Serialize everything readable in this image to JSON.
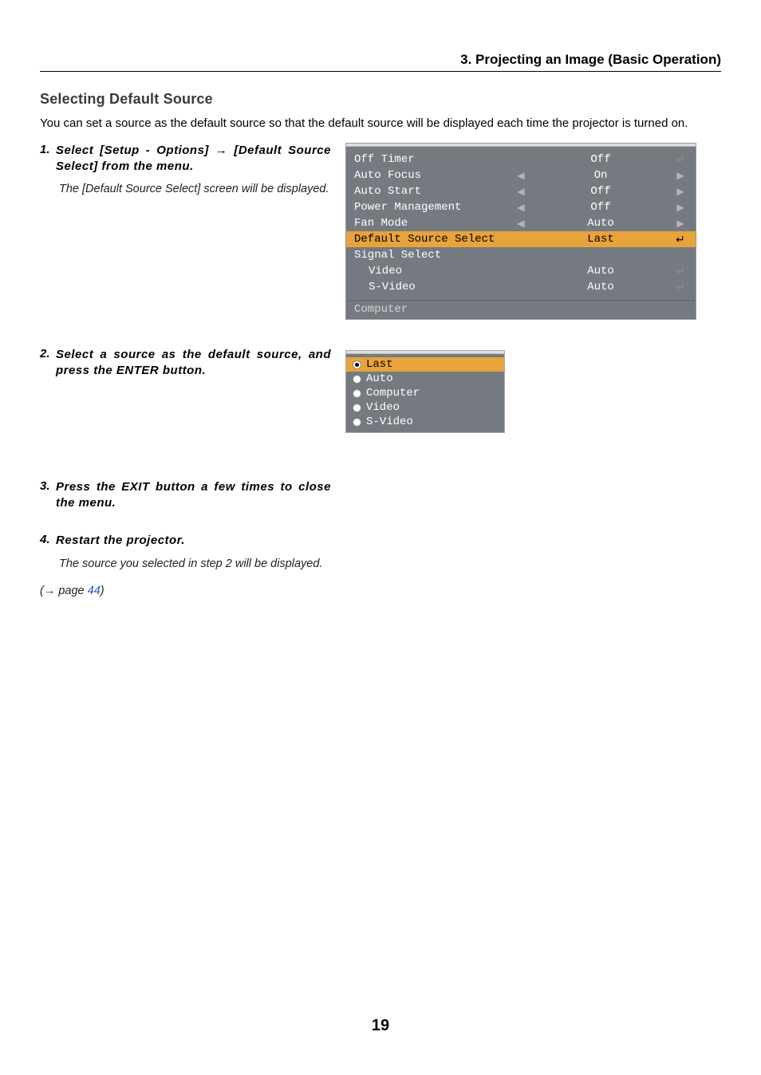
{
  "header": {
    "chapter": "3. Projecting an Image (Basic Operation)"
  },
  "section": {
    "title": "Selecting Default Source"
  },
  "intro": "You can set a source as the default source so that the default source will be displayed each time the projector is turned on.",
  "steps": [
    {
      "num": "1.",
      "text_a": "Select [Setup - Options] ",
      "arrow": "→",
      "text_b": " [Default Source Select] from the menu.",
      "note": "The [Default Source Select] screen will be displayed."
    },
    {
      "num": "2.",
      "text_a": "Select a source as the default source, and press the ENTER button.",
      "arrow": "",
      "text_b": "",
      "note": ""
    },
    {
      "num": "3.",
      "text_a": "Press the EXIT button a few times to close the menu.",
      "arrow": "",
      "text_b": "",
      "note": ""
    },
    {
      "num": "4.",
      "text_a": "Restart the projector.",
      "arrow": "",
      "text_b": "",
      "note": "The source you selected in step 2 will be displayed."
    }
  ],
  "pageref": {
    "prefix": "(→ page ",
    "num": "44",
    "suffix": ")"
  },
  "osd": {
    "rows": [
      {
        "label": "Off Timer",
        "value": "Off",
        "left": "",
        "right": "",
        "enter": "↵",
        "enterClass": "dim",
        "highlight": false,
        "sub": false
      },
      {
        "label": "Auto Focus",
        "value": "On",
        "left": "◀",
        "right": "▶",
        "enter": "",
        "enterClass": "",
        "highlight": false,
        "sub": false
      },
      {
        "label": "Auto Start",
        "value": "Off",
        "left": "◀",
        "right": "▶",
        "enter": "",
        "enterClass": "",
        "highlight": false,
        "sub": false
      },
      {
        "label": "Power Management",
        "value": "Off",
        "left": "◀",
        "right": "▶",
        "enter": "",
        "enterClass": "",
        "highlight": false,
        "sub": false
      },
      {
        "label": "Fan Mode",
        "value": "Auto",
        "left": "◀",
        "right": "▶",
        "enter": "",
        "enterClass": "",
        "highlight": false,
        "sub": false
      },
      {
        "label": "Default Source Select",
        "value": "Last",
        "left": "",
        "right": "",
        "enter": "↵",
        "enterClass": "",
        "highlight": true,
        "sub": false
      },
      {
        "label": "Signal Select",
        "value": "",
        "left": "",
        "right": "",
        "enter": "",
        "enterClass": "",
        "highlight": false,
        "sub": false
      },
      {
        "label": "Video",
        "value": "Auto",
        "left": "",
        "right": "",
        "enter": "↵",
        "enterClass": "dim",
        "highlight": false,
        "sub": true
      },
      {
        "label": "S-Video",
        "value": "Auto",
        "left": "",
        "right": "",
        "enter": "↵",
        "enterClass": "dim",
        "highlight": false,
        "sub": true
      }
    ],
    "footer": "Computer"
  },
  "popup": {
    "options": [
      {
        "label": "Last",
        "selected": true
      },
      {
        "label": "Auto",
        "selected": false
      },
      {
        "label": "Computer",
        "selected": false
      },
      {
        "label": "Video",
        "selected": false
      },
      {
        "label": "S-Video",
        "selected": false
      }
    ]
  },
  "pagenum": "19"
}
